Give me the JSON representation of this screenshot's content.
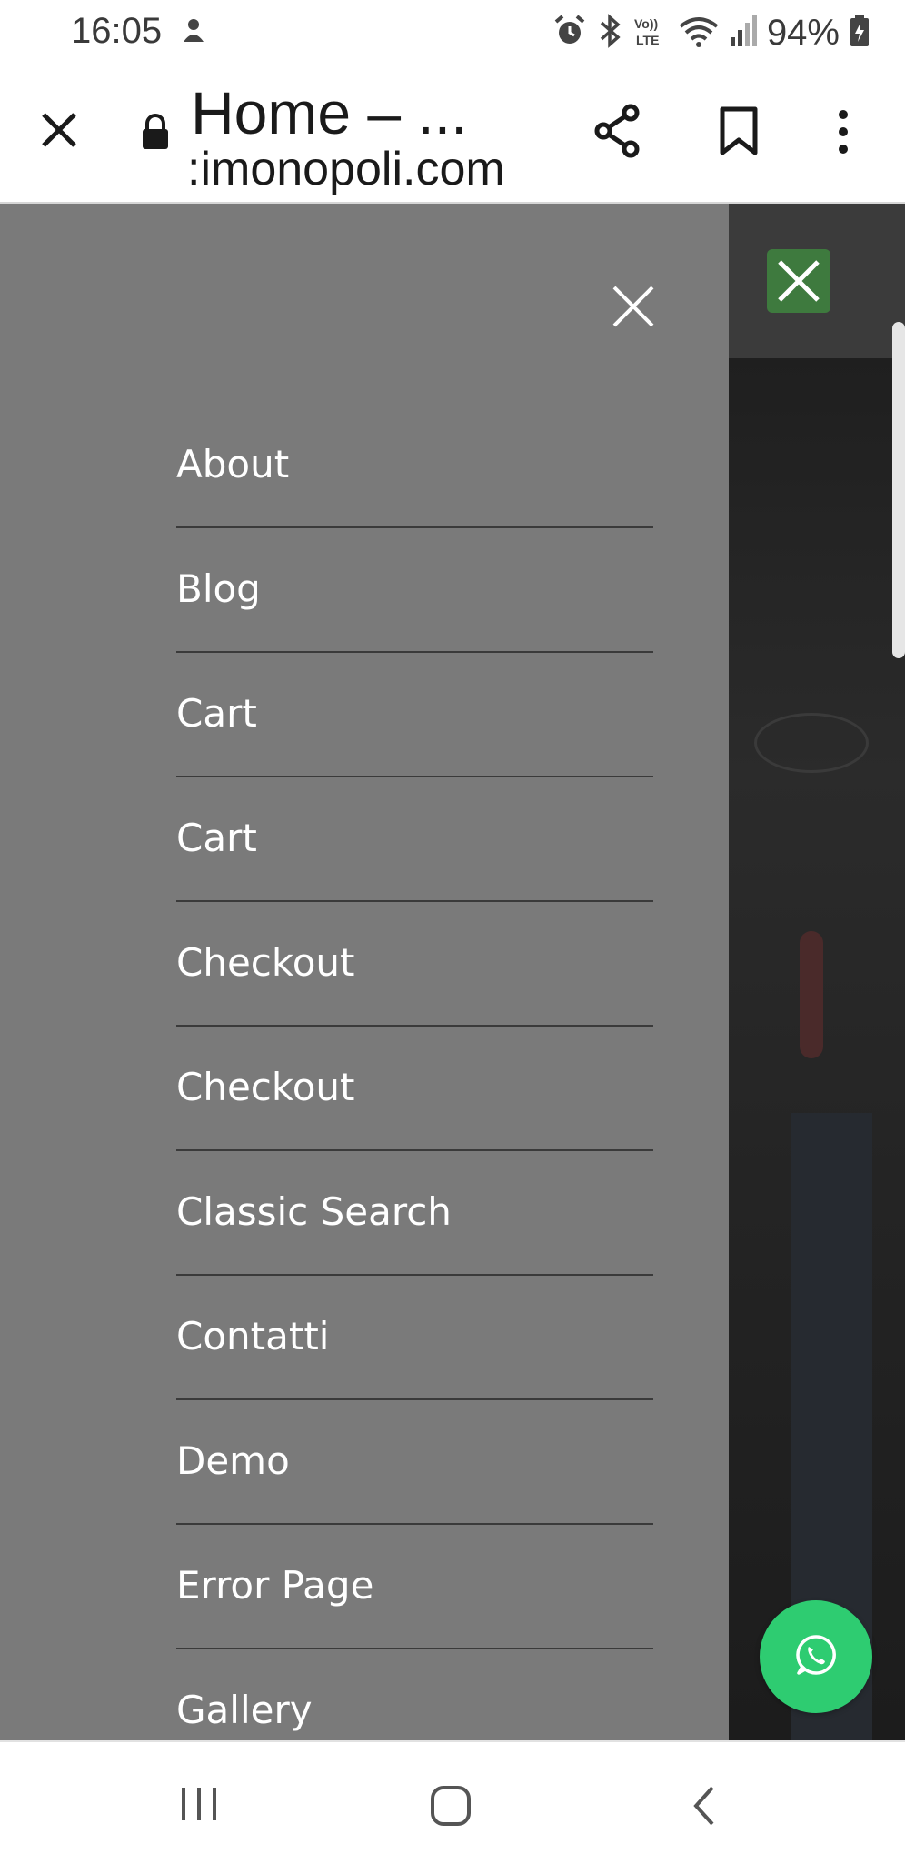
{
  "status_bar": {
    "time": "16:05",
    "battery_percent": "94%",
    "icons": [
      "notification-icon",
      "alarm-icon",
      "bluetooth-icon",
      "volte-icon",
      "wifi-icon",
      "signal-icon",
      "battery-charging-icon"
    ],
    "volte_label": "Vo))\nLTE"
  },
  "toolbar": {
    "page_title": "Home – ...",
    "url": ":imonopoli.com",
    "icons": [
      "close-icon",
      "lock-icon",
      "share-icon",
      "bookmark-icon",
      "more-vert-icon"
    ]
  },
  "drawer": {
    "close_icon": "close-icon",
    "items": [
      {
        "label": "About"
      },
      {
        "label": "Blog"
      },
      {
        "label": "Cart"
      },
      {
        "label": "Cart"
      },
      {
        "label": "Checkout"
      },
      {
        "label": "Checkout"
      },
      {
        "label": "Classic Search"
      },
      {
        "label": "Contatti"
      },
      {
        "label": "Demo"
      },
      {
        "label": "Error Page"
      },
      {
        "label": "Gallery"
      }
    ]
  },
  "page": {
    "close_button_icon": "close-icon",
    "whatsapp_icon": "whatsapp-icon"
  },
  "nav_bar": {
    "icons": [
      "recent-apps-icon",
      "home-icon",
      "back-icon"
    ]
  },
  "colors": {
    "drawer_bg": "#7a7a7a",
    "divider": "#3a3a3a",
    "whatsapp_green": "#2ecc71",
    "close_button_green": "#3e7a3e"
  }
}
